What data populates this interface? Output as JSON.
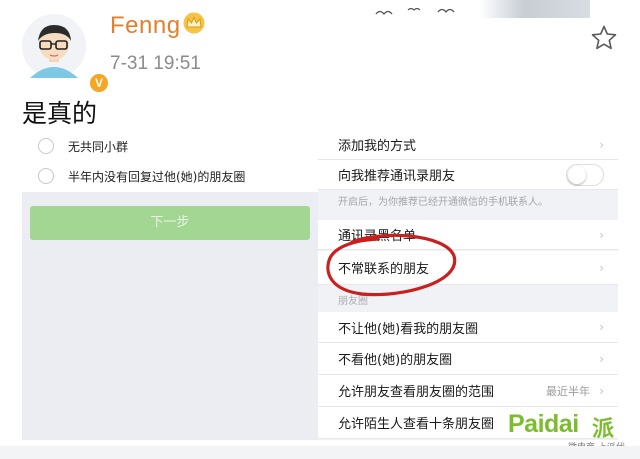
{
  "post": {
    "username": "Fenng",
    "verified_badge": "V",
    "timestamp": "7-31 19:51",
    "text": "是真的",
    "accent_color": "#e3802d"
  },
  "left_panel": {
    "options": [
      {
        "label": "无共同小群"
      },
      {
        "label": "半年内没有回复过他(她)的朋友圈"
      }
    ],
    "next_button_label": "下一步"
  },
  "right_panel": {
    "rows": [
      {
        "label": "添加我的方式",
        "control": "chevron"
      },
      {
        "label": "向我推荐通讯录朋友",
        "control": "toggle",
        "toggle_on": false
      },
      {
        "label": "通讯录黑名单",
        "control": "chevron"
      },
      {
        "label": "不常联系的朋友",
        "control": "chevron",
        "highlighted": true
      },
      {
        "label": "不让他(她)看我的朋友圈",
        "control": "chevron"
      },
      {
        "label": "不看他(她)的朋友圈",
        "control": "chevron"
      },
      {
        "label": "允许朋友查看朋友圈的范围",
        "control": "chevron",
        "value": "最近半年"
      },
      {
        "label": "允许陌生人查看十条朋友圈",
        "control": "toggle"
      }
    ],
    "hint": "开启后，为你推荐已经开通微信的手机联系人。",
    "section_label": "朋友圈"
  },
  "watermark": {
    "brand": "Paidai",
    "brand_cn": "派代",
    "tagline": "微电商 上派代",
    "color": "#7cbd2f"
  },
  "icons": [
    "crown-icon",
    "star-icon",
    "chevron-right-icon",
    "bird-decoration"
  ]
}
